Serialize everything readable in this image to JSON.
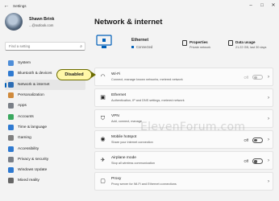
{
  "window": {
    "app_title": "Settings",
    "controls": {
      "minimize": "–",
      "maximize": "□",
      "close": "✕"
    }
  },
  "profile": {
    "name": "Shawn Brink",
    "email": "...@outlook.com"
  },
  "search": {
    "placeholder": "Find a setting"
  },
  "sidebar": {
    "items": [
      {
        "label": "System",
        "icon": "system-icon",
        "color": "#4f8ed8"
      },
      {
        "label": "Bluetooth & devices",
        "icon": "bluetooth-icon",
        "color": "#2f7ad1"
      },
      {
        "label": "Network & internet",
        "icon": "wifi-icon",
        "color": "#2b6cb4",
        "active": true
      },
      {
        "label": "Personalization",
        "icon": "brush-icon",
        "color": "#d08a3c"
      },
      {
        "label": "Apps",
        "icon": "apps-icon",
        "color": "#7a7f87"
      },
      {
        "label": "Accounts",
        "icon": "person-icon",
        "color": "#3aa85f"
      },
      {
        "label": "Time & language",
        "icon": "clock-globe-icon",
        "color": "#2f7ad1"
      },
      {
        "label": "Gaming",
        "icon": "gamepad-icon",
        "color": "#808080"
      },
      {
        "label": "Accessibility",
        "icon": "accessibility-icon",
        "color": "#2f7ad1"
      },
      {
        "label": "Privacy & security",
        "icon": "shield-icon",
        "color": "#7a7f87"
      },
      {
        "label": "Windows Update",
        "icon": "update-icon",
        "color": "#2f7ad1"
      },
      {
        "label": "Mixed reality",
        "icon": "headset-icon",
        "color": "#666666"
      }
    ]
  },
  "main": {
    "title": "Network & internet",
    "hero": {
      "name": "Ethernet",
      "status": "Connected"
    },
    "properties": {
      "label": "Properties",
      "value": "Private network"
    },
    "data_usage": {
      "label": "Data usage",
      "value": "21.22 GB, last 30 days"
    },
    "cards": [
      {
        "title": "Wi-Fi",
        "desc": "Connect, manage known networks, metered network",
        "icon": "wifi-icon",
        "toggle": "Off",
        "disabled": true,
        "chevron": true
      },
      {
        "title": "Ethernet",
        "desc": "Authentication, IP and DNS settings, metered network",
        "icon": "ethernet-icon",
        "chevron": true
      },
      {
        "title": "VPN",
        "desc": "Add, connect, manage",
        "icon": "vpn-shield-icon",
        "chevron": true
      },
      {
        "title": "Mobile hotspot",
        "desc": "Share your internet connection",
        "icon": "hotspot-icon",
        "toggle": "Off",
        "chevron": true
      },
      {
        "title": "Airplane mode",
        "desc": "Stop all wireless communication",
        "icon": "airplane-icon",
        "toggle": "Off",
        "chevron": true
      },
      {
        "title": "Proxy",
        "desc": "Proxy server for Wi-Fi and Ethernet connections",
        "icon": "proxy-icon",
        "chevron": true
      }
    ]
  },
  "annotations": {
    "callout": "Disabled",
    "watermark": "ElevenForum.com"
  }
}
